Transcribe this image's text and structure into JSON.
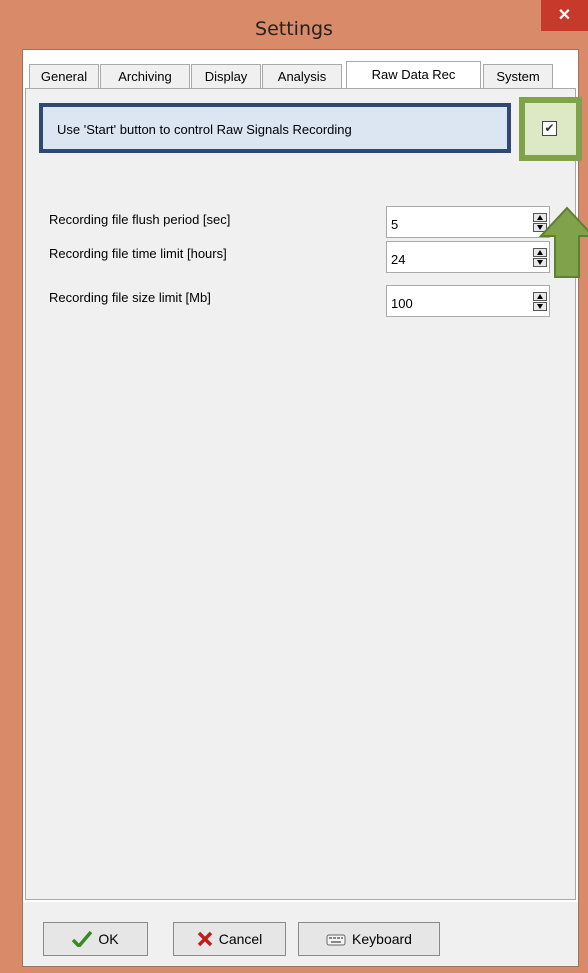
{
  "window": {
    "title": "Settings",
    "close_glyph": "✕"
  },
  "tabs": [
    {
      "label": "General"
    },
    {
      "label": "Archiving"
    },
    {
      "label": "Display"
    },
    {
      "label": "Analysis"
    },
    {
      "label": "Raw Data Rec",
      "active": true
    },
    {
      "label": "System"
    }
  ],
  "raw_data_rec": {
    "start_control_label": "Use 'Start' button to control Raw Signals Recording",
    "start_control_checked": true,
    "check_glyph": "✔",
    "fields": [
      {
        "label": "Recording file flush period [sec]",
        "value": "5"
      },
      {
        "label": "Recording file time limit [hours]",
        "value": "24"
      },
      {
        "label": "Recording file size limit [Mb]",
        "value": "100"
      }
    ]
  },
  "buttons": {
    "ok_label": "OK",
    "cancel_label": "Cancel",
    "keyboard_label": "Keyboard"
  },
  "icons": {
    "ok": "checkmark-icon",
    "cancel": "x-icon",
    "keyboard": "keyboard-icon",
    "annotation": "arrow-up-icon"
  },
  "colors": {
    "window_frame": "#d98a68",
    "close_button": "#c7392b",
    "highlight_box_border": "#2e4a73",
    "highlight_box_fill": "#dce6f2",
    "annotation_green": "#7fa24a"
  }
}
